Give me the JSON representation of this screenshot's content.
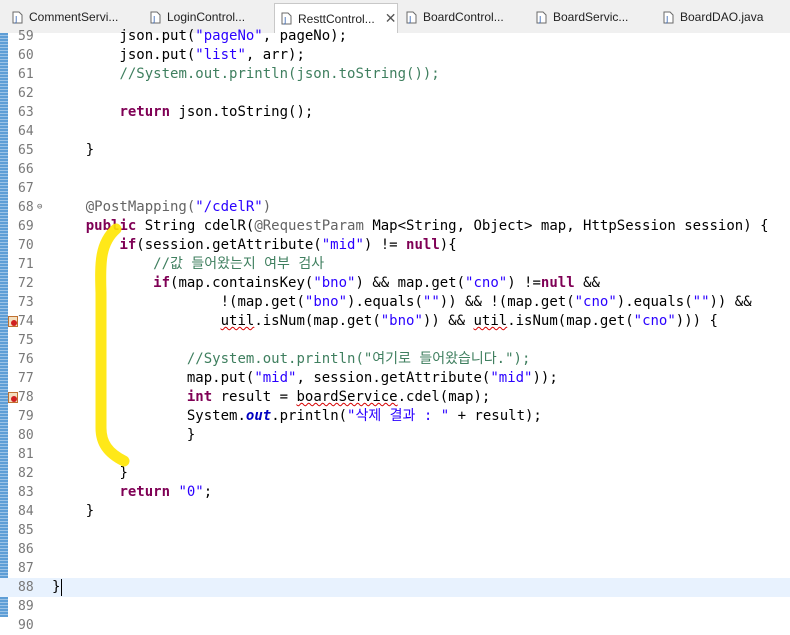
{
  "tabs": [
    {
      "label": "CommentServi...",
      "active": false
    },
    {
      "label": "LoginControl...",
      "active": false
    },
    {
      "label": "ResttControl...",
      "active": true
    },
    {
      "label": "BoardControl...",
      "active": false
    },
    {
      "label": "BoardServic...",
      "active": false
    },
    {
      "label": "BoardDAO.java",
      "active": false
    }
  ],
  "tab_close_symbol": "✕",
  "line_numbers": [
    "59",
    "60",
    "61",
    "62",
    "63",
    "64",
    "65",
    "66",
    "67",
    "68",
    "69",
    "70",
    "71",
    "72",
    "73",
    "74",
    "75",
    "76",
    "77",
    "78",
    "79",
    "80",
    "81",
    "82",
    "83",
    "84",
    "85",
    "86",
    "87",
    "88",
    "89",
    "90"
  ],
  "code": {
    "l59": {
      "a": "json.put(",
      "b": "\"pageNo\"",
      "c": ", pageNo);"
    },
    "l60": {
      "a": "json.put(",
      "b": "\"list\"",
      "c": ", arr);"
    },
    "l61": "//System.out.println(json.toString());",
    "l63": {
      "kw": "return",
      "rest": " json.toString();"
    },
    "l65": "}",
    "l68": {
      "an": "@PostMapping(",
      "str": "\"/cdelR\"",
      "end": ")"
    },
    "l69": {
      "kw": "public",
      "t1": " String cdelR(",
      "an": "@RequestParam",
      "t2": " Map<String, Object> ",
      "v1": "map",
      "t3": ", HttpSession ",
      "v2": "session",
      "t4": ") {"
    },
    "l70": {
      "kw": "if",
      "t1": "(session.getAttribute(",
      "str": "\"mid\"",
      "t2": ") != ",
      "kw2": "null",
      "t3": "){"
    },
    "l71": "//값 들어왔는지 여부 검사",
    "l72": {
      "kw": "if",
      "t1": "(map.containsKey(",
      "s1": "\"bno\"",
      "t2": ") && map.get(",
      "s2": "\"cno\"",
      "t3": ") !=",
      "kw2": "null",
      "t4": " &&"
    },
    "l73": {
      "t1": "!(map.get(",
      "s1": "\"bno\"",
      "t2": ").equals(",
      "s2": "\"\"",
      "t3": ")) && !(map.get(",
      "s3": "\"cno\"",
      "t4": ").equals(",
      "s4": "\"\"",
      "t5": ")) &&"
    },
    "l74": {
      "u1": "util",
      "t1": ".isNum(map.get(",
      "s1": "\"bno\"",
      "t2": ")) && ",
      "u2": "util",
      "t3": ".isNum(map.get(",
      "s2": "\"cno\"",
      "t4": "))) {"
    },
    "l76": "//System.out.println(\"여기로 들어왔습니다.\");",
    "l77": {
      "t1": "map.put(",
      "s1": "\"mid\"",
      "t2": ", session.getAttribute(",
      "s2": "\"mid\"",
      "t3": "));"
    },
    "l78": {
      "kw": "int",
      "t1": " result = ",
      "f": "boardService",
      "t2": ".cdel(map);"
    },
    "l79": {
      "t1": "System.",
      "st": "out",
      "t2": ".println(",
      "s1": "\"삭제 결과 : \"",
      "t3": " + result);"
    },
    "l80": "}",
    "l82": "}",
    "l83": {
      "kw": "return",
      "t1": " ",
      "s1": "\"0\"",
      "t2": ";"
    },
    "l84": "}",
    "l88": "}"
  },
  "colors": {
    "keyword": "#7f0055",
    "string": "#2a00ff",
    "comment": "#3f7f5f",
    "annotation": "#646464",
    "highlight": "#ffe600",
    "current_line": "#e8f2fe"
  }
}
